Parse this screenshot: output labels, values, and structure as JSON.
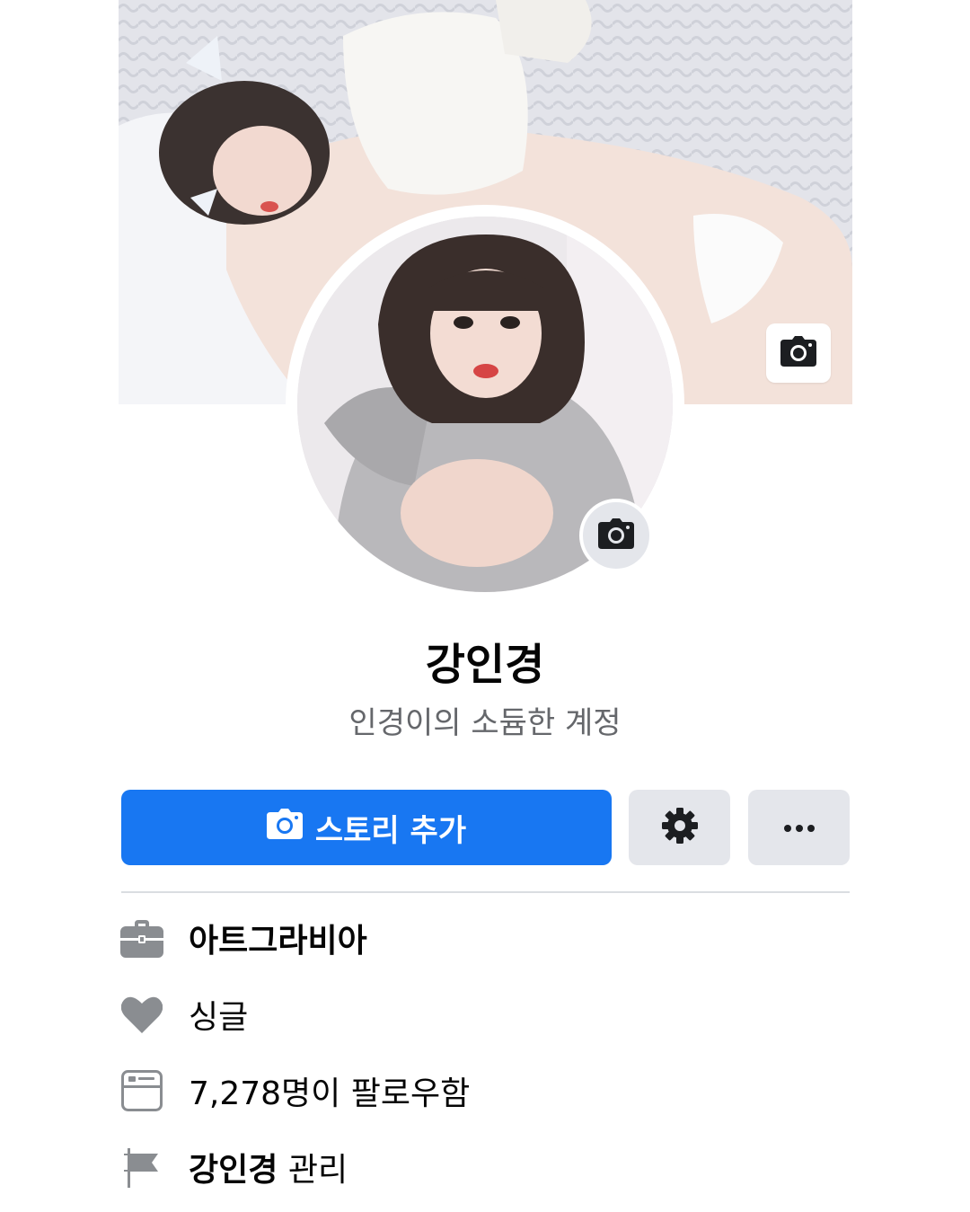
{
  "profile": {
    "name": "강인경",
    "bio": "인경이의 소듐한 계정"
  },
  "actions": {
    "add_story_label": "스토리 추가",
    "settings_icon": "gear-icon",
    "more_icon": "more-dots-icon"
  },
  "info": {
    "work": "아트그라비아",
    "relationship": "싱글",
    "followers": "7,278명이 팔로우함",
    "manage_name": "강인경",
    "manage_suffix": "관리"
  },
  "colors": {
    "primary_button": "#1877f2",
    "secondary_button": "#e4e6eb",
    "icon_gray": "#8a8d91",
    "secondary_text": "#65676b"
  }
}
